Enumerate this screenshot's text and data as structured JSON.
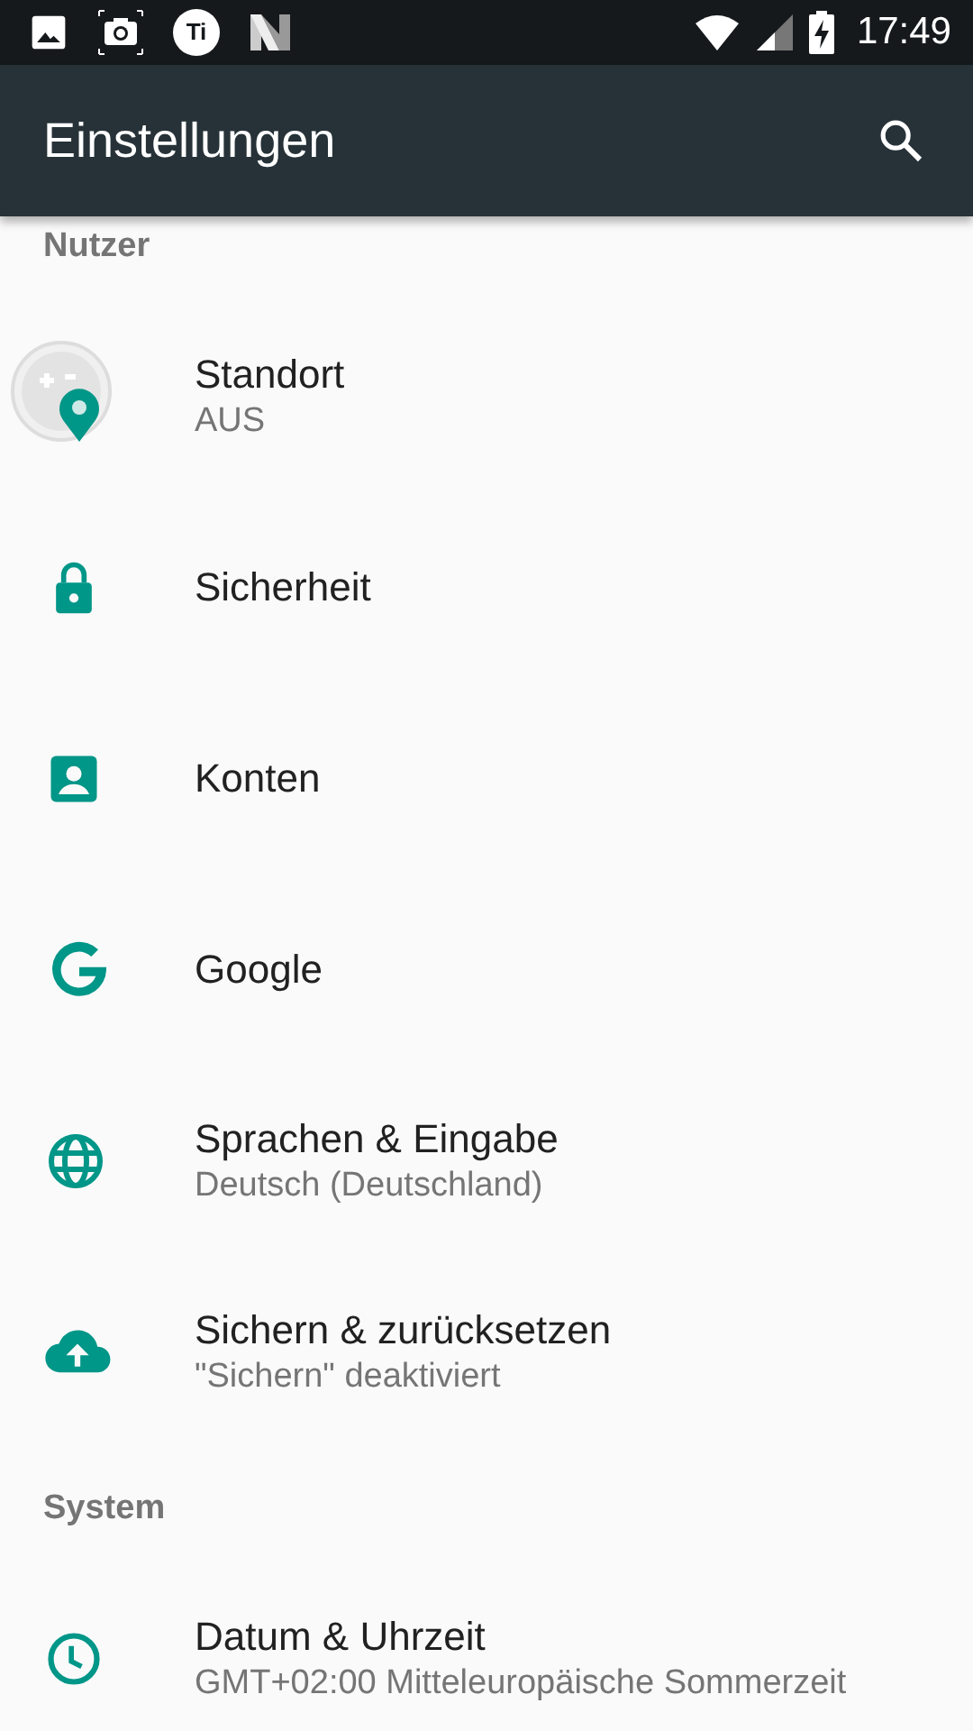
{
  "status_bar": {
    "badge_text": "Ti",
    "time": "17:49"
  },
  "toolbar": {
    "title": "Einstellungen"
  },
  "list": [
    {
      "kind": "header",
      "title": "Nutzer"
    },
    {
      "kind": "item",
      "title": "Standort",
      "subtitle": "AUS"
    },
    {
      "kind": "item",
      "title": "Sicherheit"
    },
    {
      "kind": "item",
      "title": "Konten"
    },
    {
      "kind": "item",
      "title": "Google"
    },
    {
      "kind": "item",
      "title": "Sprachen & Eingabe",
      "subtitle": "Deutsch (Deutschland)"
    },
    {
      "kind": "item",
      "title": "Sichern & zurücksetzen",
      "subtitle": "\"Sichern\" deaktiviert"
    },
    {
      "kind": "header",
      "title": "System"
    },
    {
      "kind": "item",
      "title": "Datum & Uhrzeit",
      "subtitle": "GMT+02:00 Mitteleuropäische Sommerzeit"
    }
  ]
}
